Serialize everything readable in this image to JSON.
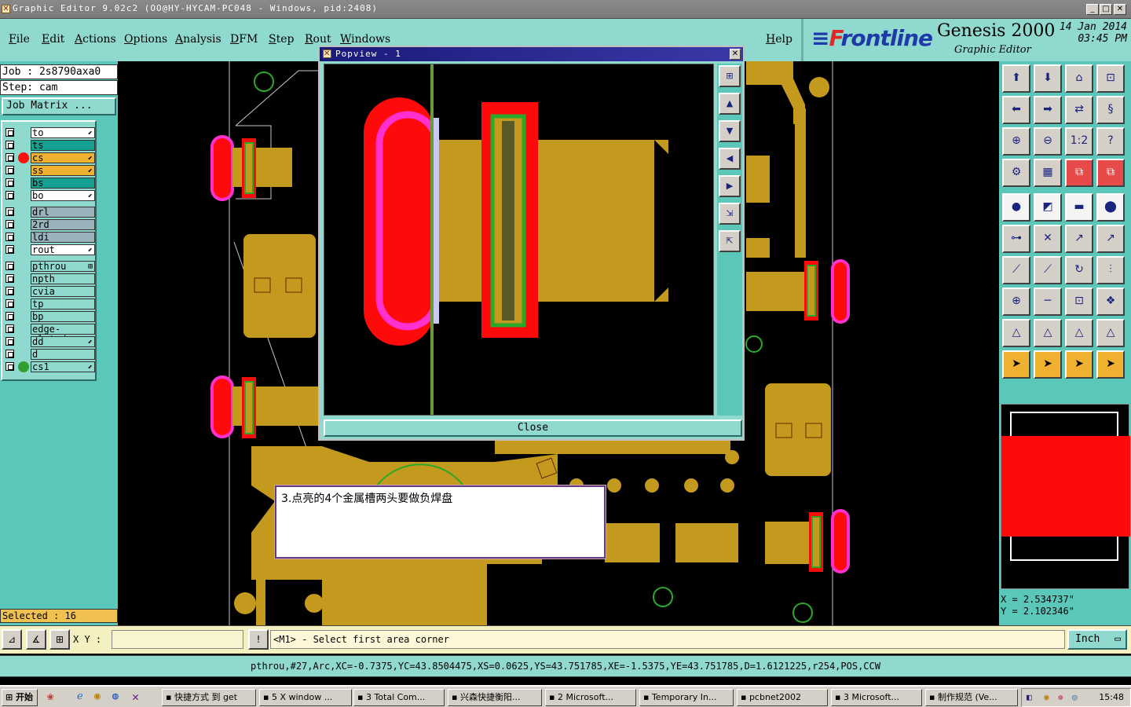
{
  "window": {
    "title": "Graphic Editor 9.02c2 (OO@HY-HYCAM-PC048 - Windows, pid:2408)"
  },
  "menu": [
    {
      "id": "file",
      "label": "File"
    },
    {
      "id": "edit",
      "label": "Edit"
    },
    {
      "id": "actions",
      "label": "Actions"
    },
    {
      "id": "options",
      "label": "Options"
    },
    {
      "id": "analysis",
      "label": "Analysis"
    },
    {
      "id": "dfm",
      "label": "DFM"
    },
    {
      "id": "step",
      "label": "Step"
    },
    {
      "id": "rout",
      "label": "Rout"
    },
    {
      "id": "windows",
      "label": "Windows"
    },
    {
      "id": "help",
      "label": "Help"
    }
  ],
  "brand": {
    "logo_f": "F",
    "logo_rest": "rontline",
    "product": "Genesis 2000",
    "subtitle": "Graphic Editor",
    "date": "14 Jan 2014",
    "time": "03:45 PM"
  },
  "job": {
    "job_line": "Job : 2s8790axa0",
    "step_line": "Step: cam",
    "matrix_button": "Job Matrix ..."
  },
  "layers": [
    {
      "name": "to",
      "color": "#ffffff",
      "dot": "",
      "edit": "⬋"
    },
    {
      "name": "ts",
      "color": "#14a090",
      "dot": "",
      "edit": ""
    },
    {
      "name": "cs",
      "color": "#f0b030",
      "dot": "#ff1010",
      "edit": "⬋"
    },
    {
      "name": "ss",
      "color": "#f0b030",
      "dot": "",
      "edit": "⬋"
    },
    {
      "name": "bs",
      "color": "#14a090",
      "dot": "",
      "edit": ""
    },
    {
      "name": "bo",
      "color": "#ffffff",
      "dot": "",
      "edit": "⬋"
    },
    {
      "name": "drl",
      "color": "#9ab2bc",
      "dot": "",
      "edit": ""
    },
    {
      "name": "2rd",
      "color": "#9ab2bc",
      "dot": "",
      "edit": ""
    },
    {
      "name": "ldi",
      "color": "#9ab2bc",
      "dot": "",
      "edit": ""
    },
    {
      "name": "rout",
      "color": "#ffffff",
      "dot": "",
      "edit": "⬋"
    },
    {
      "name": "pthrou",
      "color": "#8fd9cf",
      "dot": "",
      "edit": "⊞"
    },
    {
      "name": "npth",
      "color": "#8fd9cf",
      "dot": "",
      "edit": ""
    },
    {
      "name": "cvia",
      "color": "#8fd9cf",
      "dot": "",
      "edit": ""
    },
    {
      "name": "tp",
      "color": "#8fd9cf",
      "dot": "",
      "edit": ""
    },
    {
      "name": "bp",
      "color": "#8fd9cf",
      "dot": "",
      "edit": ""
    },
    {
      "name": "edge-plated",
      "color": "#8fd9cf",
      "dot": "",
      "edit": ""
    },
    {
      "name": "dd",
      "color": "#8fd9cf",
      "dot": "",
      "edit": "⬋"
    },
    {
      "name": "d",
      "color": "#8fd9cf",
      "dot": "",
      "edit": ""
    },
    {
      "name": "cs1",
      "color": "#8fd9cf",
      "dot": "#30a030",
      "edit": "⬋"
    }
  ],
  "selected": "Selected : 16",
  "popup": {
    "title": "Popview - 1",
    "close_button": "Close"
  },
  "note": {
    "text": "3.点亮的4个金属槽两头要做负焊盘"
  },
  "coords": {
    "x": "X = 2.534737\"",
    "y": "Y = 2.102346\""
  },
  "cmd": {
    "xy_label": "X Y :",
    "xy_value": "",
    "message": "<M1> - Select first area corner",
    "unit": "Inch"
  },
  "info": "pthrou,#27,Arc,XC=-0.7375,YC=43.8504475,XS=0.0625,YS=43.751785,XE=-1.5375,YE=43.751785,D=1.6121225,r254,POS,CCW",
  "taskbar": {
    "start": "开始",
    "items": [
      "快捷方式 到 get",
      "5 X window ...",
      "3 Total Com...",
      "兴森快捷衡阳...",
      "2 Microsoft...",
      "Temporary In...",
      "pcbnet2002",
      "3 Microsoft...",
      "制作规范 (Ve..."
    ],
    "clock": "15:48"
  },
  "colors": {
    "copper": "#c49a1e",
    "pad_red": "#ff0a0a",
    "outline_magenta": "#ff30d0",
    "panel_teal": "#8fd9cf",
    "green_ring": "#2aa82a"
  }
}
